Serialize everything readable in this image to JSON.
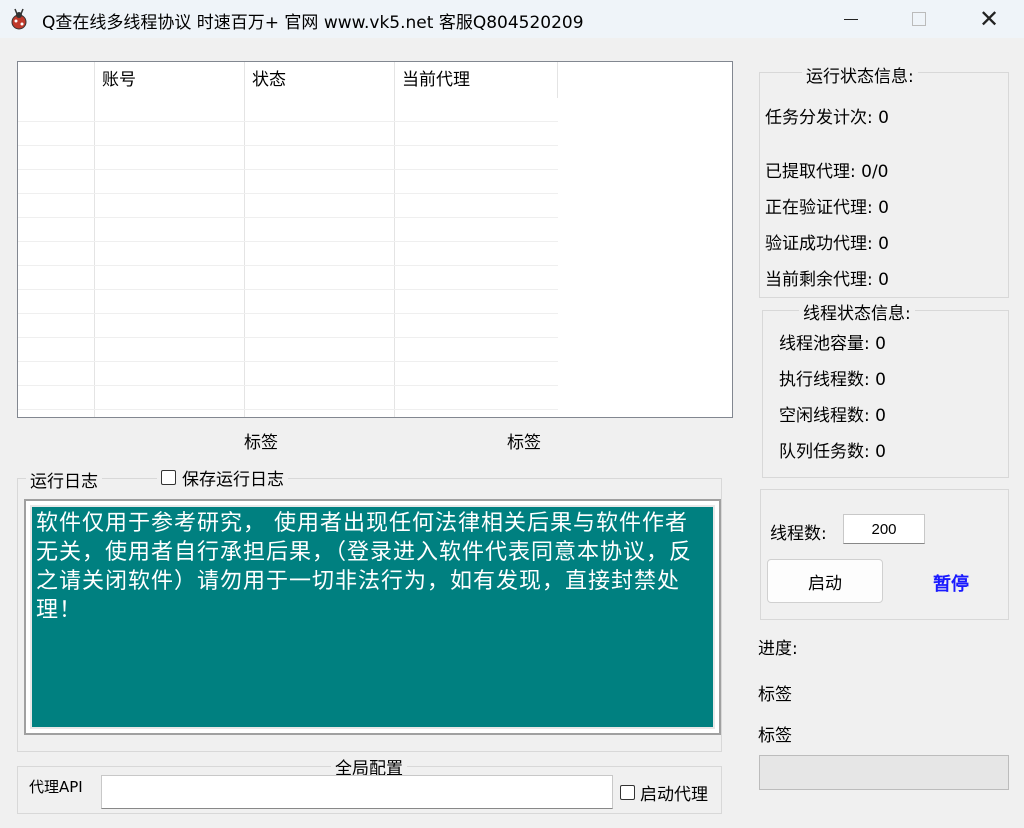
{
  "window": {
    "title": "Q查在线多线程协议 时速百万+ 官网 www.vk5.net 客服Q804520209",
    "minimize_icon": "minimize-icon",
    "maximize_icon": "maximize-icon",
    "close_icon": "close-icon"
  },
  "table": {
    "columns": [
      "",
      "账号",
      "状态",
      "当前代理",
      ""
    ],
    "rows": []
  },
  "labels": {
    "tag1": "标签",
    "tag2": "标签"
  },
  "log": {
    "group_title": "运行日志",
    "save_checkbox_label": "保存运行日志",
    "save_checked": false,
    "text": "软件仅用于参考研究， 使用者出现任何法律相关后果与软件作者无关，使用者自行承担后果，（登录进入软件代表同意本协议，反之请关闭软件）请勿用于一切非法行为，如有发现，直接封禁处理！"
  },
  "config": {
    "group_title": "全局配置",
    "proxy_api_label": "代理API",
    "proxy_api_value": "",
    "enable_proxy_label": "启动代理",
    "enable_proxy_checked": false
  },
  "run_status": {
    "title": "运行状态信息:",
    "task_dispatch": "任务分发计次: 0",
    "fetched_proxy": "已提取代理: 0/0",
    "verifying_proxy": "正在验证代理: 0",
    "verified_proxy": "验证成功代理: 0",
    "remaining_proxy": "当前剩余代理: 0"
  },
  "thread_status": {
    "title": "线程状态信息:",
    "pool_capacity": "线程池容量: 0",
    "running_threads": "执行线程数: 0",
    "idle_threads": "空闲线程数: 0",
    "queue_tasks": "队列任务数: 0"
  },
  "controls": {
    "thread_count_label": "线程数:",
    "thread_count_value": "200",
    "start_label": "启动",
    "pause_label": "暂停"
  },
  "progress": {
    "label": "进度:",
    "tag1": "标签",
    "tag2": "标签",
    "value": 0
  },
  "colors": {
    "log_bg": "#008080",
    "pause_link": "#1a1aff"
  }
}
